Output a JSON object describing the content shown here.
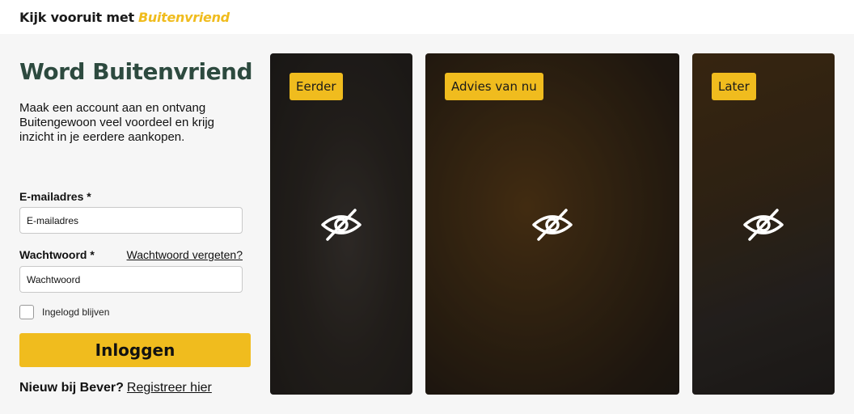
{
  "header": {
    "lead": "Kijk vooruit met",
    "brand": "Buitenvriend"
  },
  "form": {
    "title": "Word Buitenvriend",
    "intro": "Maak een account aan en ontvang Buitengewoon veel voordeel en krijg inzicht in je eerdere aankopen.",
    "email_label": "E-mailadres *",
    "email_placeholder": "E-mailadres",
    "password_label": "Wachtwoord *",
    "password_placeholder": "Wachtwoord",
    "forgot_link": "Wachtwoord vergeten?",
    "remember_label": "Ingelogd blijven",
    "login_button": "Inloggen",
    "new_question": "Nieuw bij Bever?",
    "register_link": "Registreer hier"
  },
  "cards": [
    {
      "badge": "Eerder",
      "icon": "eye-slash-icon"
    },
    {
      "badge": "Advies van nu",
      "icon": "eye-slash-icon"
    },
    {
      "badge": "Later",
      "icon": "eye-slash-icon"
    }
  ],
  "colors": {
    "accent": "#f0bc1e",
    "title_green": "#2d4a3f",
    "background": "#f6f6f6"
  }
}
